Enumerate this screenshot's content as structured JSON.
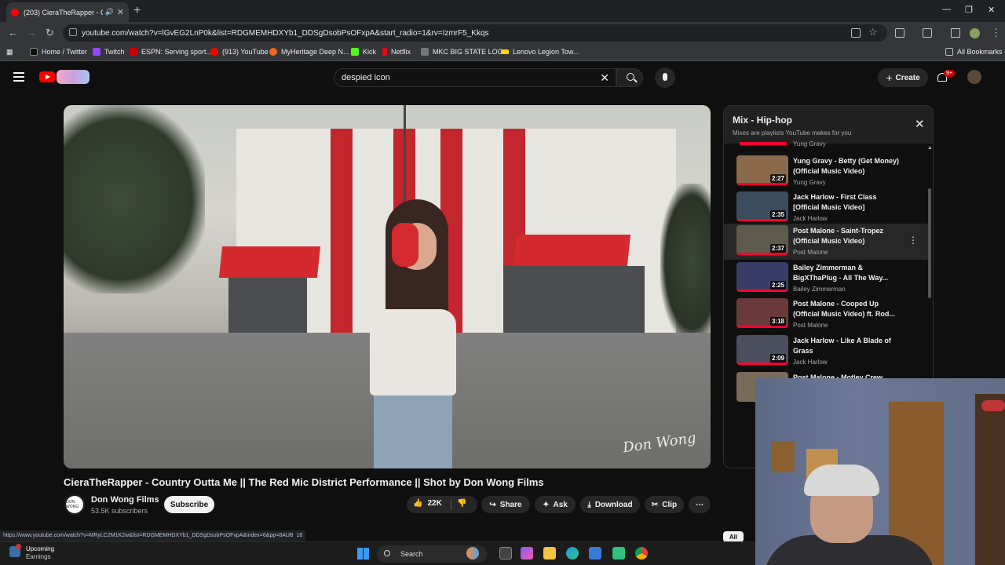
{
  "browser": {
    "tab_title": "(203) CieraTheRapper - Co...",
    "url": "youtube.com/watch?v=lGvEG2LnP0k&list=RDGMEMHDXYb1_DDSgDsobPsOFxpA&start_radio=1&rv=IzmrF5_Kkqs",
    "bookmarks": [
      {
        "label": "Home / Twitter",
        "color": "#1d1d1d"
      },
      {
        "label": "Twitch",
        "color": "#9146ff"
      },
      {
        "label": "ESPN: Serving sport...",
        "color": "#cc0000"
      },
      {
        "label": "(913) YouTube",
        "color": "#ff0000"
      },
      {
        "label": "MyHeritage Deep N...",
        "color": "#f26522"
      },
      {
        "label": "Kick",
        "color": "#53fc18"
      },
      {
        "label": "Netflix",
        "color": "#e50914"
      },
      {
        "label": "MKC BIG STATE LOG...",
        "color": "#777777"
      },
      {
        "label": "Lenovo Legion Tow...",
        "color": "#f5d90a"
      }
    ],
    "all_bookmarks": "All Bookmarks",
    "status_url": "https://www.youtube.com/watch?v=MRyLC2M1K2w&list=RDGMEMHDXYb1_DDSgDsobPsOFxpA&index=6&pp=8AUB",
    "status_extra": "18"
  },
  "youtube": {
    "search_value": "despied icon",
    "create_label": "Create",
    "notif_count": "9+",
    "video": {
      "title": "CieraTheRapper - Country Outta Me || The Red Mic District Performance || Shot by Don Wong Films",
      "channel": "Don Wong Films",
      "subscribers": "53.5K subscribers",
      "subscribe_label": "Subscribe",
      "likes": "22K",
      "share_label": "Share",
      "ask_label": "Ask",
      "download_label": "Download",
      "clip_label": "Clip",
      "watermark": "Don Wong",
      "avatar_text": "DON WONG"
    },
    "mix": {
      "title": "Mix - Hip-hop",
      "subtitle": "Mixes are playlists YouTube makes for you",
      "prev_channel": "Yung Gravy",
      "items": [
        {
          "title": "Yung Gravy - Betty (Get Money) (Official Music Video)",
          "channel": "Yung Gravy",
          "duration": "2:27",
          "thumb": "#8a6a4a"
        },
        {
          "title": "Jack Harlow - First Class [Official Music Video]",
          "channel": "Jack Harlow",
          "duration": "2:35",
          "thumb": "#3a4c5e"
        },
        {
          "title": "Post Malone - Saint-Tropez (Official Music Video)",
          "channel": "Post Malone",
          "duration": "2:37",
          "thumb": "#5e5a4c"
        },
        {
          "title": "Bailey Zimmerman & BigXThaPlug - All The Way...",
          "channel": "Bailey Zimmerman",
          "duration": "2:25",
          "thumb": "#3a3e66"
        },
        {
          "title": "Post Malone - Cooped Up (Official Music Video) ft. Rod...",
          "channel": "Post Malone",
          "duration": "3:18",
          "thumb": "#6a3a3a"
        },
        {
          "title": "Jack Harlow - Like A Blade of Grass",
          "channel": "Jack Harlow",
          "duration": "2:09",
          "thumb": "#4a4e5e"
        },
        {
          "title": "Post Malone - Motley Crew",
          "channel": "",
          "duration": "",
          "thumb": "#7a6a5a"
        }
      ]
    },
    "all_chip": "All"
  },
  "taskbar": {
    "weather_title": "Upcoming",
    "weather_sub": "Earnings",
    "search_label": "Search"
  }
}
